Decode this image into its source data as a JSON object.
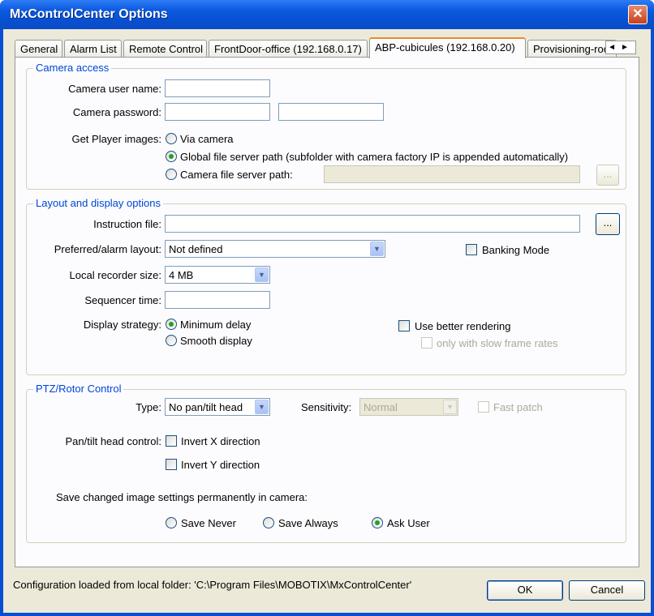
{
  "window": {
    "title": "MxControlCenter Options",
    "close_glyph": "✕"
  },
  "tabs": [
    "General",
    "Alarm List",
    "Remote Control",
    "FrontDoor-office (192.168.0.17)",
    "ABP-cubicules (192.168.0.20)",
    "Provisioning-room"
  ],
  "tab_scroll": "◄►",
  "camera_access": {
    "title": "Camera access",
    "user_label": "Camera user name:",
    "user_value": "",
    "password_label": "Camera password:",
    "password_value": "",
    "password_confirm_value": "",
    "player_label": "Get Player images:",
    "opt_via_camera": "Via camera",
    "opt_global": "Global file server path (subfolder with camera factory IP is appended automatically)",
    "opt_camera_path": "Camera file server path:",
    "camera_path_value": "",
    "browse": "..."
  },
  "layout": {
    "title": "Layout and display options",
    "instruction_label": "Instruction file:",
    "instruction_value": "",
    "browse": "...",
    "preferred_label": "Preferred/alarm layout:",
    "preferred_value": "Not defined",
    "banking_label": "Banking Mode",
    "recorder_label": "Local recorder size:",
    "recorder_value": "4 MB",
    "sequencer_label": "Sequencer time:",
    "sequencer_value": "",
    "strategy_label": "Display strategy:",
    "opt_min_delay": "Minimum delay",
    "opt_smooth": "Smooth display",
    "better_rendering": "Use better rendering",
    "slow_frame": "only with slow frame rates"
  },
  "ptz": {
    "title": "PTZ/Rotor Control",
    "type_label": "Type:",
    "type_value": "No pan/tilt head",
    "sensitivity_label": "Sensitivity:",
    "sensitivity_value": "Normal",
    "fast_patch": "Fast patch",
    "pan_label": "Pan/tilt head control:",
    "invert_x": "Invert X direction",
    "invert_y": "Invert Y direction",
    "save_label": "Save changed image settings permanently in camera:",
    "opt_never": "Save Never",
    "opt_always": "Save Always",
    "opt_ask": "Ask User"
  },
  "footer": {
    "status": "Configuration loaded from local folder: 'C:\\Program Files\\MOBOTIX\\MxControlCenter'",
    "ok": "OK",
    "cancel": "Cancel"
  },
  "colors": {
    "title_bar": "#0a4fd1",
    "group_title": "#0046d5",
    "dialog_bg": "#ece9d8",
    "radio_dot": "#21a121"
  }
}
